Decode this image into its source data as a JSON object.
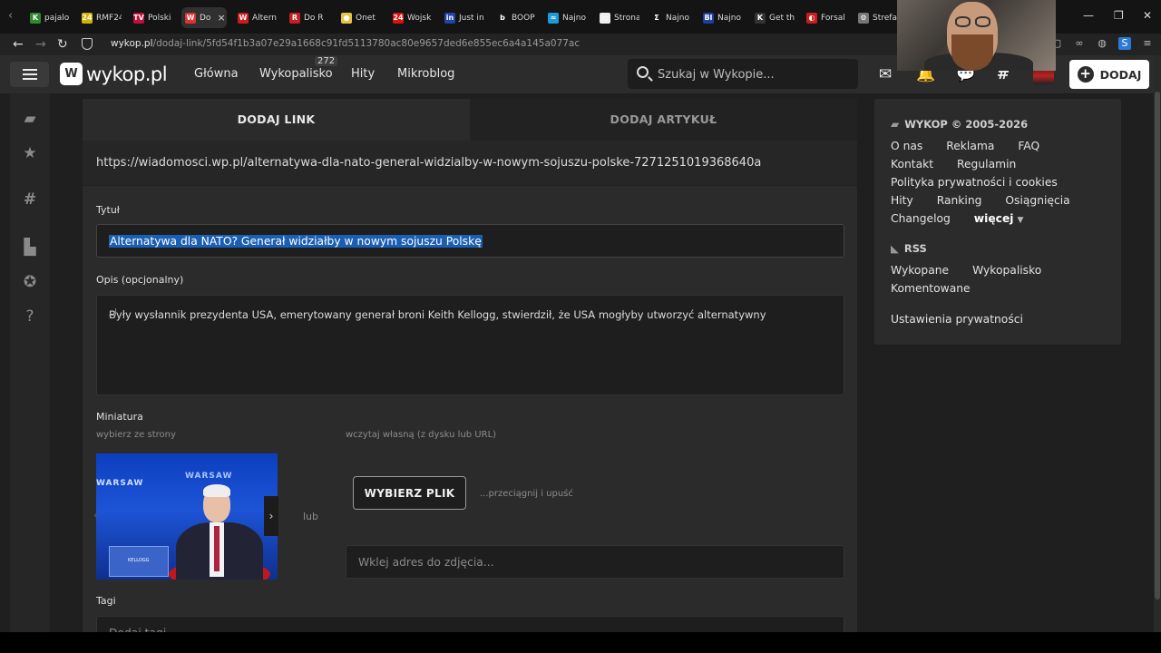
{
  "browser": {
    "tabs": [
      {
        "label": "pajalo",
        "color": "#2e8b2e",
        "glyph": "K"
      },
      {
        "label": "RMF24",
        "color": "#d4b000",
        "glyph": "24"
      },
      {
        "label": "Polski",
        "color": "#c0103a",
        "glyph": "TV"
      },
      {
        "label": "Do",
        "color": "#d33",
        "glyph": "W",
        "active": true
      },
      {
        "label": "Altern",
        "color": "#c81e1e",
        "glyph": "W"
      },
      {
        "label": "Do R",
        "color": "#c81e1e",
        "glyph": "R"
      },
      {
        "label": "Onet",
        "color": "#e8c440",
        "glyph": "●"
      },
      {
        "label": "Wojsk",
        "color": "#d11",
        "glyph": "24"
      },
      {
        "label": "Just in",
        "color": "#2244aa",
        "glyph": "in"
      },
      {
        "label": "BOOP",
        "color": "#141414",
        "glyph": "b"
      },
      {
        "label": "Najno",
        "color": "#1e9ad6",
        "glyph": "≈"
      },
      {
        "label": "Strona",
        "color": "#eeeeee",
        "glyph": "▭"
      },
      {
        "label": "Najno",
        "color": "#141414",
        "glyph": "Σ"
      },
      {
        "label": "Najno",
        "color": "#1f3fa0",
        "glyph": "BI"
      },
      {
        "label": "Get th",
        "color": "#333",
        "glyph": "K"
      },
      {
        "label": "Forsal",
        "color": "#c81e1e",
        "glyph": "◐"
      },
      {
        "label": "Strefa",
        "color": "#777",
        "glyph": "⚙"
      }
    ],
    "close_tab_label": "×",
    "url_host": "wykop.pl",
    "url_path": "/dodaj-link/5fd54f1b3a07e29a1668c91fd5113780ac80e9657ded6e855ec6a4a145a077ac"
  },
  "header": {
    "logo_text": "wykop.pl",
    "nav": [
      "Główna",
      "Wykopalisko",
      "Hity",
      "Mikroblog"
    ],
    "wykopalisko_badge": "272",
    "search_placeholder": "Szukaj w Wykopie...",
    "add_button_label": "DODAJ"
  },
  "form": {
    "tabs": [
      "DODAJ LINK",
      "DODAJ ARTYKUŁ"
    ],
    "source_url": "https://wiadomosci.wp.pl/alternatywa-dla-nato-general-widzialby-w-nowym-sojuszu-polske-7271251019368640a",
    "title_label": "Tytuł",
    "title_value": "Alternatywa dla NATO? Generał widziałby w nowym sojuszu Polskę",
    "desc_label": "Opis (opcjonalny)",
    "desc_value": "Były wysłannik prezydenta USA, emerytowany generał broni Keith Kellogg, stwierdził, że USA mogłyby utworzyć alternatywny",
    "thumb_label": "Miniatura",
    "thumb_from_page": "wybierz ze strony",
    "thumb_own": "wczytaj własną (z dysku lub URL)",
    "thumb_banner": "WARSAW",
    "thumb_banner2": "WARSAW",
    "thumb_caption": "KELLOGG",
    "or_label": "lub",
    "choose_file_label": "WYBIERZ PLIK",
    "drag_label": "...przeciągnij i upuść",
    "image_url_placeholder": "Wklej adres do zdjęcia...",
    "tags_label": "Tagi",
    "tags_placeholder": "Dodaj tagi"
  },
  "sidebar": {
    "copyright": "WYKOP © 2005-2026",
    "links_row1": [
      "O nas",
      "Reklama",
      "FAQ"
    ],
    "links_row2": [
      "Kontakt",
      "Regulamin"
    ],
    "links_row3": [
      "Polityka prywatności i cookies"
    ],
    "links_row4": [
      "Hity",
      "Ranking",
      "Osiągnięcia"
    ],
    "links_row5": [
      "Changelog",
      "więcej"
    ],
    "rss": "RSS",
    "rss_row1": [
      "Wykopane",
      "Wykopalisko"
    ],
    "rss_row2": [
      "Komentowane"
    ],
    "privacy_settings": "Ustawienia prywatności"
  }
}
